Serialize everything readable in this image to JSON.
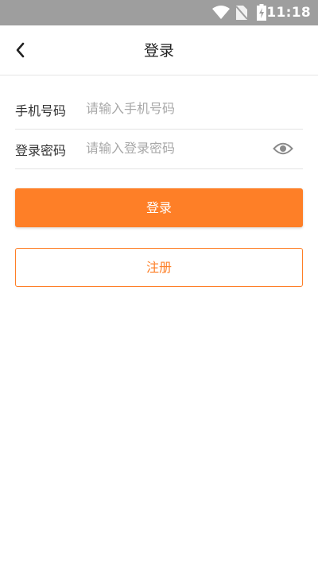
{
  "status_bar": {
    "time": "11:18",
    "icons": [
      "wifi-icon",
      "no-sim-icon",
      "battery-charging-icon"
    ]
  },
  "nav": {
    "back_icon": "chevron-left-icon",
    "title": "登录"
  },
  "form": {
    "phone": {
      "label": "手机号码",
      "placeholder": "请输入手机号码",
      "value": ""
    },
    "password": {
      "label": "登录密码",
      "placeholder": "请输入登录密码",
      "value": "",
      "toggle_icon": "eye-icon"
    }
  },
  "actions": {
    "login_label": "登录",
    "register_label": "注册"
  },
  "colors": {
    "accent": "#fe7f27",
    "status_bar": "#9e9e9e",
    "placeholder": "#a8a8a8"
  }
}
